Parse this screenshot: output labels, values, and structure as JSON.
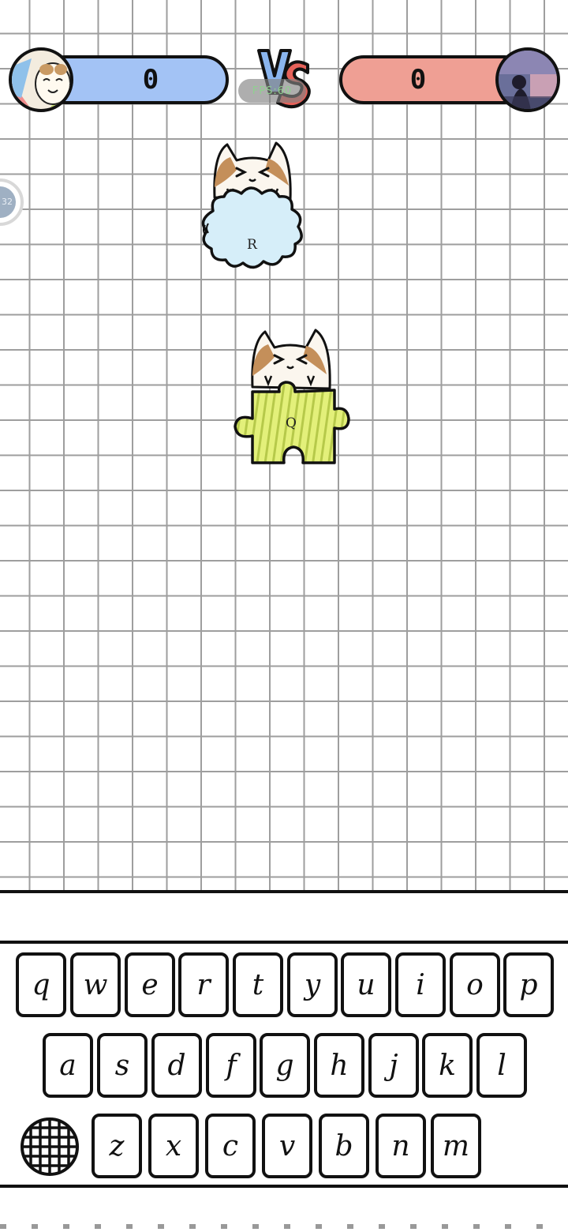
{
  "header": {
    "left_score": "0",
    "right_score": "0",
    "vs_label": "VS",
    "fps_label": "FPS:60"
  },
  "side_handle": {
    "label": "32"
  },
  "falling_pieces": [
    {
      "letter": "R",
      "shape": "cloud",
      "color": "#d6eef9"
    },
    {
      "letter": "Q",
      "shape": "puzzle",
      "color": "#e3f07a"
    }
  ],
  "keyboard": {
    "row1": [
      "q",
      "w",
      "e",
      "r",
      "t",
      "y",
      "u",
      "i",
      "o",
      "p"
    ],
    "row2": [
      "a",
      "s",
      "d",
      "f",
      "g",
      "h",
      "j",
      "k",
      "l"
    ],
    "row3": [
      "z",
      "x",
      "c",
      "v",
      "b",
      "n",
      "m"
    ],
    "globe_icon": "grid-globe-icon"
  },
  "colors": {
    "left_bar": "#a3c3f5",
    "right_bar": "#ef9f94",
    "grid_line": "#9e9e9e"
  }
}
